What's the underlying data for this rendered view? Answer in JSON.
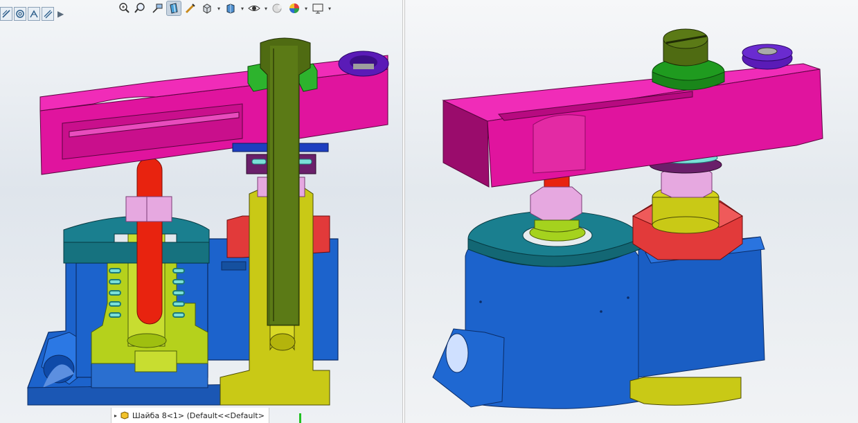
{
  "viewport_left": {
    "hud_icons": [
      "zoom-to-fit-icon",
      "zoom-area-icon",
      "previous-view-icon",
      "section-view-icon",
      "dynamic-annotation-icon",
      "view-orientation-icon",
      "display-style-icon",
      "hide-show-icon",
      "edit-appearance-icon",
      "apply-scene-icon",
      "view-settings-icon"
    ],
    "active_icon": "section-view-icon",
    "quick_icons": [
      "sketch-line-icon",
      "circle-target-icon",
      "smart-dimension-icon",
      "diagonal-line-icon"
    ]
  },
  "viewport_right": {
    "hud_icons": [
      "zoom-to-fit-icon",
      "zoom-area-icon",
      "previous-view-icon",
      "section-view-icon",
      "dynamic-annotation-icon",
      "view-orientation-icon",
      "display-style-icon",
      "hide-show-icon",
      "edit-appearance-icon",
      "apply-scene-icon",
      "view-settings-icon"
    ]
  },
  "feature_tree": {
    "partial_item": "Шайба 8<1> (Default<<Default>"
  },
  "colors": {
    "clamp_bar": "#e0149e",
    "body": "#1c63cc",
    "cap": "#1a7f8f",
    "bolt": "#4f6b12",
    "bushing": "#c9c916",
    "nut_red": "#e23a3a",
    "pin_red": "#e8230f",
    "hex_pink": "#e6a8e0",
    "washer_green": "#1f9b1f",
    "cap_nut_purple": "#5a1bb7"
  }
}
